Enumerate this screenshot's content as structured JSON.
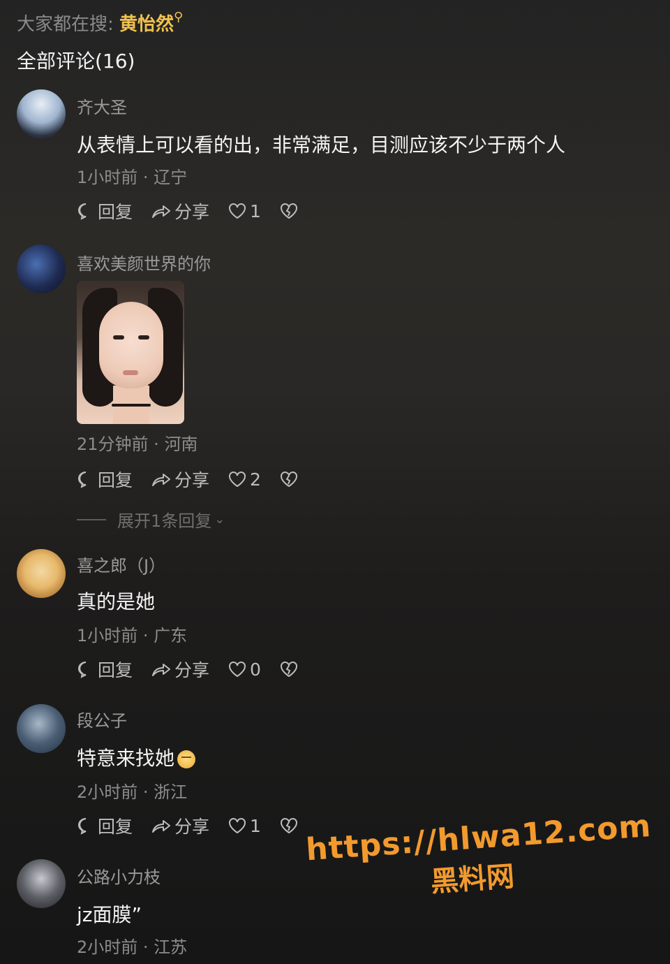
{
  "search_hint": {
    "prefix": "大家都在搜:",
    "keyword": "黄怡然"
  },
  "comments_header": "全部评论(16)",
  "actions": {
    "reply": "回复",
    "share": "分享"
  },
  "comments": [
    {
      "username": "齐大圣",
      "text": "从表情上可以看的出，非常满足，目测应该不少于两个人",
      "time": "1小时前",
      "location": "辽宁",
      "likes": "1"
    },
    {
      "username": "喜欢美颜世界的你",
      "time": "21分钟前",
      "location": "河南",
      "likes": "2",
      "expand": "展开1条回复"
    },
    {
      "username": "喜之郎（J）",
      "text": "真的是她",
      "time": "1小时前",
      "location": "广东",
      "likes": "0"
    },
    {
      "username": "段公子",
      "text": "特意来找她",
      "time": "2小时前",
      "location": "浙江",
      "likes": "1"
    },
    {
      "username": "公路小力枝",
      "text": "jz面膜”",
      "time": "2小时前",
      "location": "江苏"
    }
  ],
  "watermark": {
    "url": "https://hlwa12.com",
    "site": "黑料网"
  },
  "colors": {
    "keyword": "#f2c14e",
    "watermark": "#f29a2e"
  }
}
